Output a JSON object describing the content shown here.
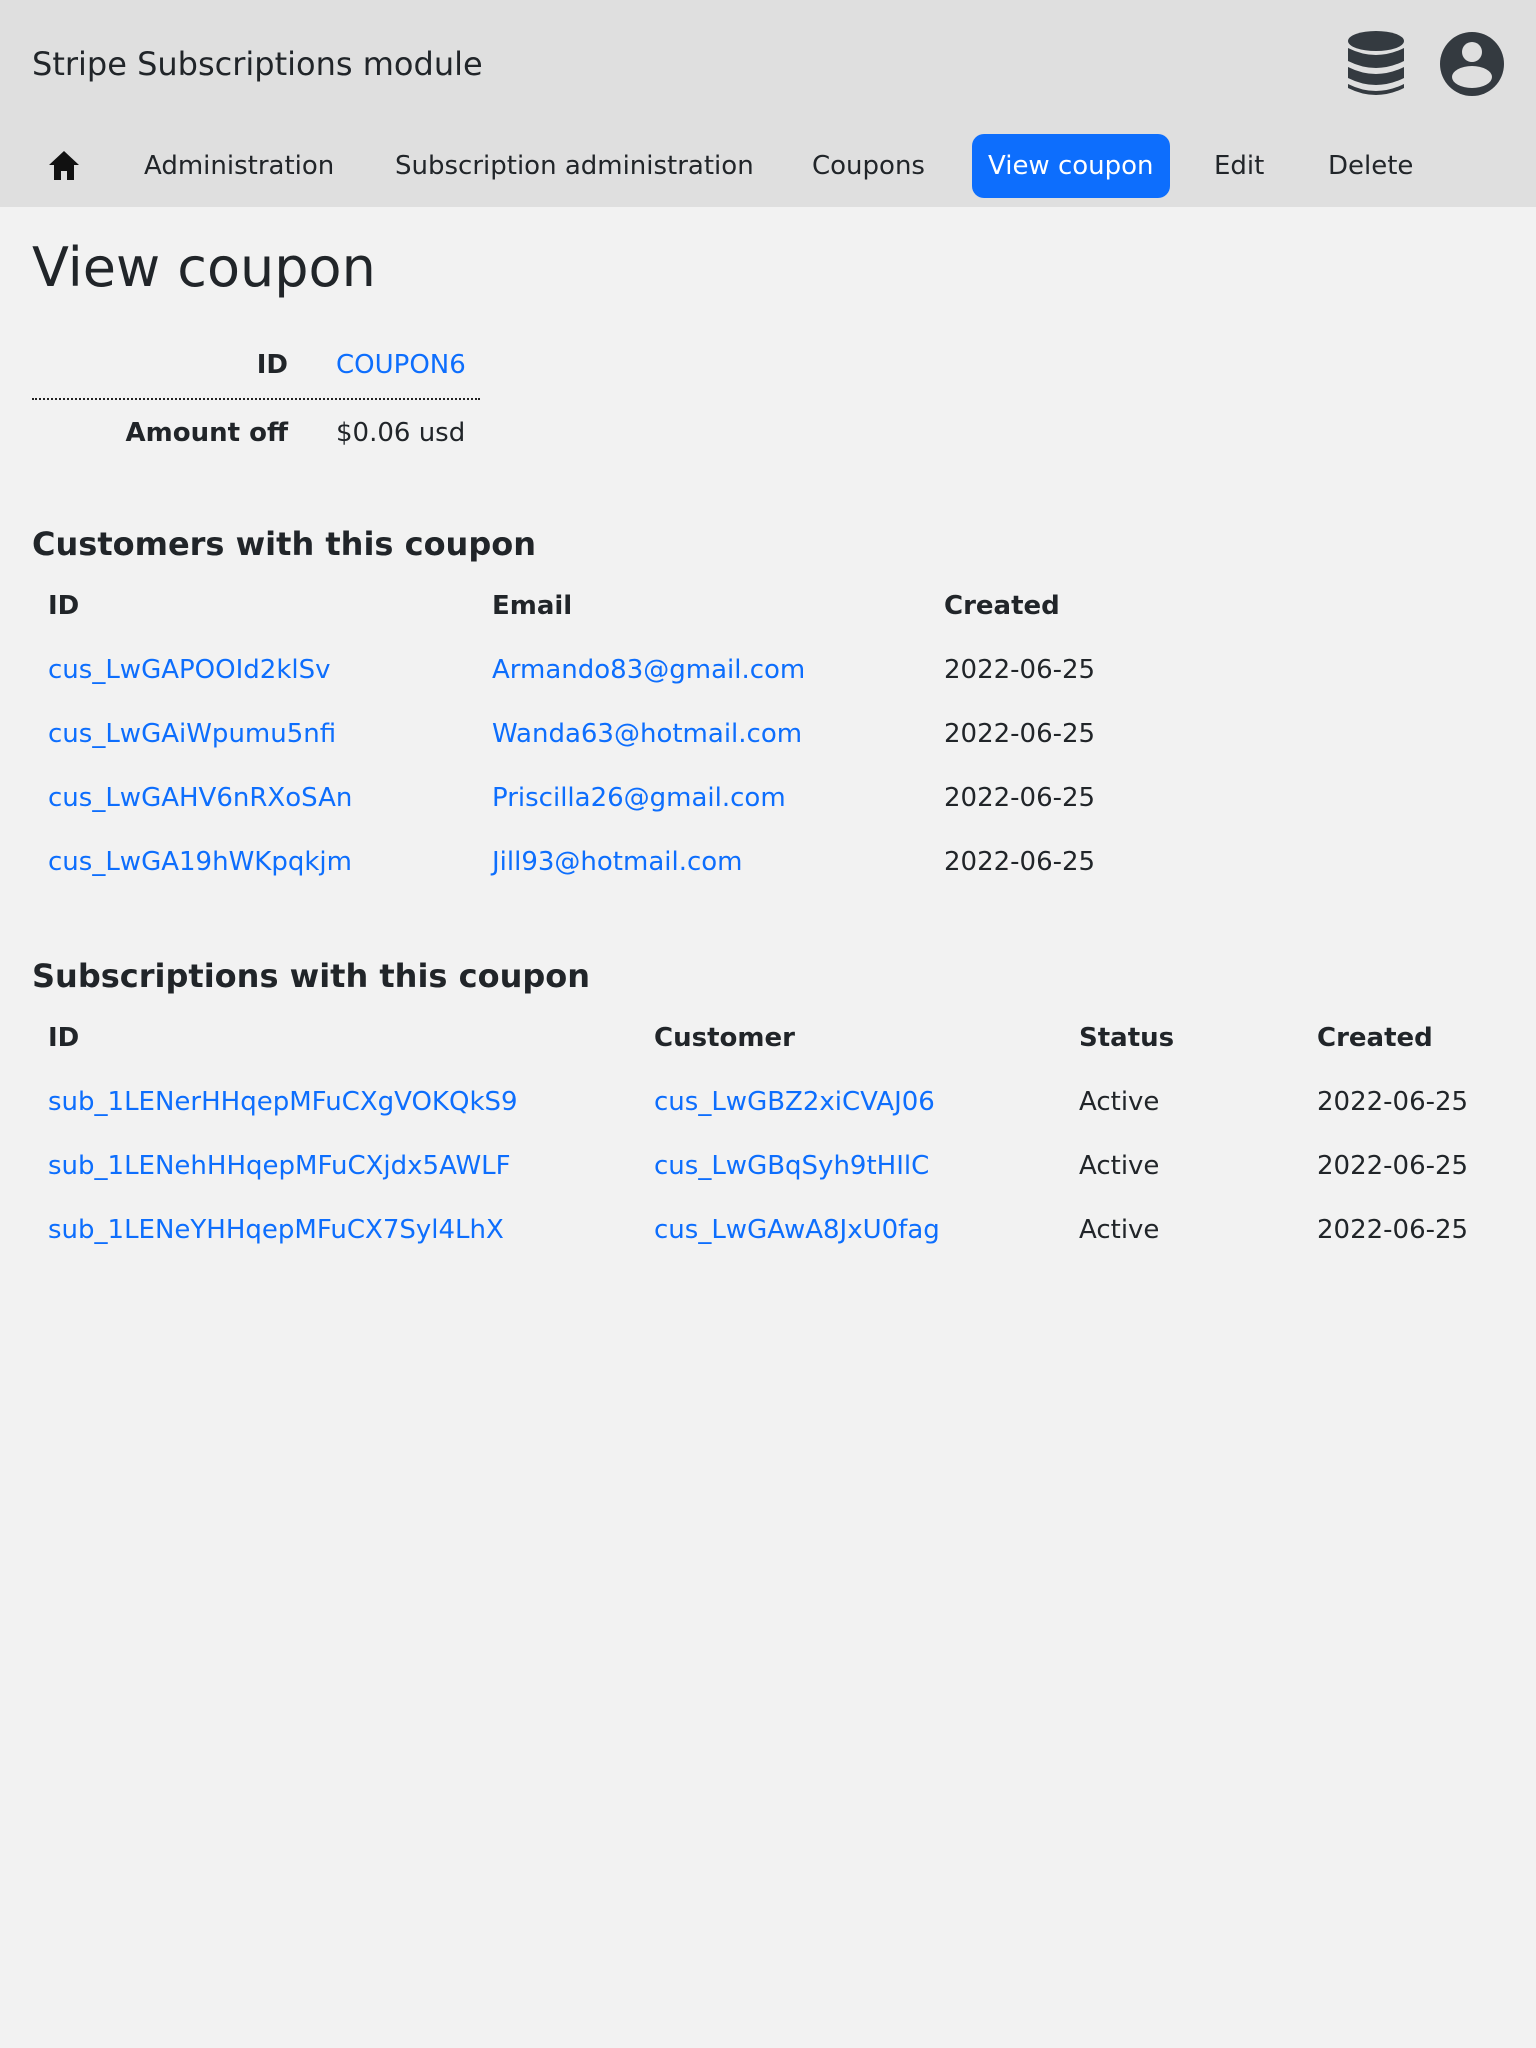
{
  "header": {
    "app_title": "Stripe Subscriptions module",
    "icons": [
      "database-icon",
      "user-account-icon"
    ]
  },
  "nav": {
    "home_icon": "home-icon",
    "items": [
      {
        "label": "Administration"
      },
      {
        "label": "Subscription administration"
      },
      {
        "label": "Coupons"
      },
      {
        "label": "View coupon",
        "active": true
      },
      {
        "label": "Edit"
      },
      {
        "label": "Delete"
      }
    ]
  },
  "page": {
    "title": "View coupon"
  },
  "coupon": {
    "id_label": "ID",
    "id_value": "COUPON6",
    "amount_label": "Amount off",
    "amount_value": "$0.06 usd"
  },
  "customers": {
    "title": "Customers with this coupon",
    "columns": [
      "ID",
      "Email",
      "Created"
    ],
    "rows": [
      {
        "id": "cus_LwGAPOOId2klSv",
        "email": "Armando83@gmail.com",
        "created": "2022-06-25"
      },
      {
        "id": "cus_LwGAiWpumu5nfi",
        "email": "Wanda63@hotmail.com",
        "created": "2022-06-25"
      },
      {
        "id": "cus_LwGAHV6nRXoSAn",
        "email": "Priscilla26@gmail.com",
        "created": "2022-06-25"
      },
      {
        "id": "cus_LwGA19hWKpqkjm",
        "email": "Jill93@hotmail.com",
        "created": "2022-06-25"
      }
    ]
  },
  "subscriptions": {
    "title": "Subscriptions with this coupon",
    "columns": [
      "ID",
      "Customer",
      "Status",
      "Created"
    ],
    "rows": [
      {
        "id": "sub_1LENerHHqepMFuCXgVOKQkS9",
        "customer": "cus_LwGBZ2xiCVAJ06",
        "status": "Active",
        "created": "2022-06-25"
      },
      {
        "id": "sub_1LENehHHqepMFuCXjdx5AWLF",
        "customer": "cus_LwGBqSyh9tHIlC",
        "status": "Active",
        "created": "2022-06-25"
      },
      {
        "id": "sub_1LENeYHHqepMFuCX7Syl4LhX",
        "customer": "cus_LwGAwA8JxU0fag",
        "status": "Active",
        "created": "2022-06-25"
      }
    ]
  },
  "colors": {
    "accent": "#0d6efd",
    "topbar": "#dfdfdf",
    "background": "#f2f2f2",
    "text": "#212529"
  }
}
